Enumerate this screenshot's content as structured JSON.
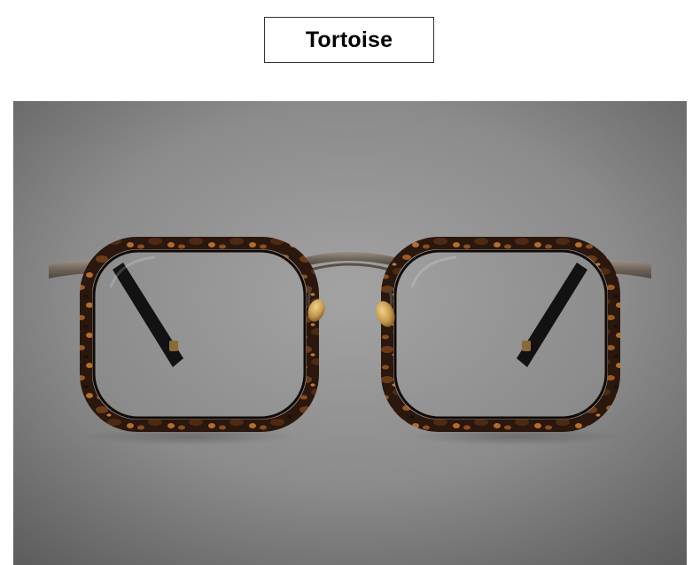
{
  "header": {
    "color_label": "Tortoise"
  },
  "product_photo": {
    "subject_icon": "eyeglasses-icon",
    "colors": {
      "background_light": "#9a9a9a",
      "background_dark": "#5e5e5e",
      "tortoise_dark": "#1e120c",
      "tortoise_mid": "#5a3217",
      "tortoise_light": "#b06a2a",
      "metal": "#7a6f63",
      "nose_pad": "#c79a4e"
    }
  }
}
